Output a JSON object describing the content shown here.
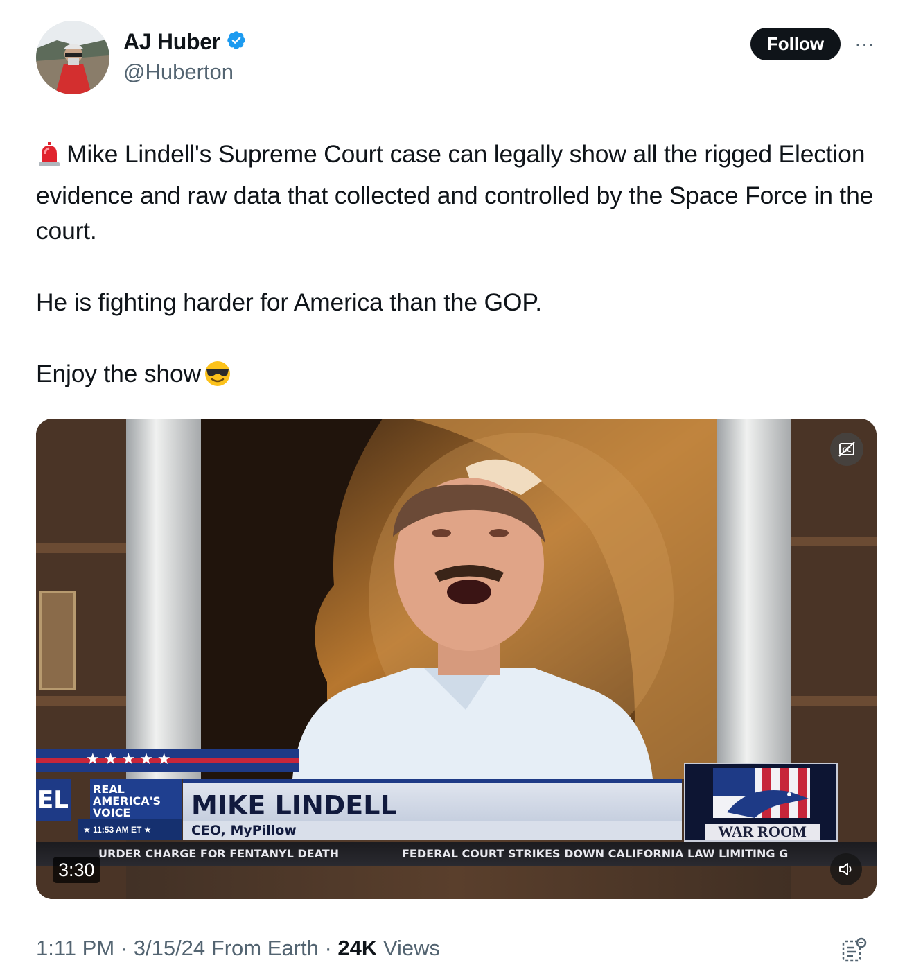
{
  "user": {
    "display_name": "AJ Huber",
    "handle": "@Huberton",
    "verified": true,
    "avatar_icon": "avatar-photo"
  },
  "actions": {
    "follow_label": "Follow",
    "more_label": "···"
  },
  "tweet": {
    "line1": "Mike Lindell's Supreme Court case can legally show all the rigged Election evidence and raw data that collected and controlled by the Space Force in the court.",
    "line2": "He is fighting harder for America than the GOP.",
    "line3": "Enjoy the show",
    "emoji_start": "rotating-light",
    "emoji_end": "smiling-face-with-sunglasses"
  },
  "video": {
    "duration": "3:30",
    "lower_third": {
      "stars": "★★★★★",
      "network_line1": "REAL",
      "network_line2": "AMERICA'S",
      "network_line3": "VOICE",
      "time": "★ 11:53 AM ET ★",
      "edge_text": "EL",
      "name": "MIKE LINDELL",
      "title": "CEO, MyPillow",
      "show_logo": "WAR ROOM",
      "ticker_1": "URDER CHARGE FOR FENTANYL DEATH",
      "ticker_2": "FEDERAL COURT STRIKES DOWN CALIFORNIA LAW LIMITING G"
    },
    "captions_icon": "closed-captions-icon",
    "volume_icon": "volume-icon"
  },
  "meta": {
    "time": "1:11 PM",
    "separator": "·",
    "date": "3/15/24",
    "source": "From Earth",
    "views_count": "24K",
    "views_label": "Views"
  }
}
